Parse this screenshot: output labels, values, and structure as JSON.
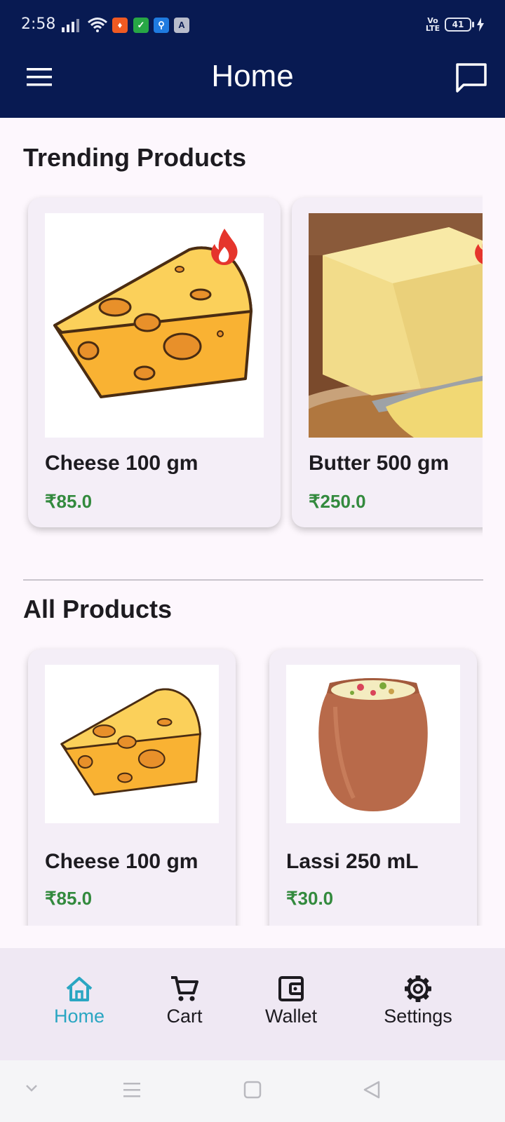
{
  "status_bar": {
    "time": "2:58",
    "volte": "Vo LTE",
    "battery": "41"
  },
  "app_bar": {
    "title": "Home",
    "menu_icon": "hamburger-menu-icon",
    "chat_icon": "chat-bubble-icon"
  },
  "trending": {
    "title": "Trending Products",
    "items": [
      {
        "name": "Cheese 100 gm",
        "price": "₹85.0",
        "image": "cheese-wedge",
        "badge": "fire-icon"
      },
      {
        "name": "Butter 500 gm",
        "price": "₹250.0",
        "image": "butter-block",
        "badge": "fire-icon"
      }
    ]
  },
  "all_products": {
    "title": "All Products",
    "items": [
      {
        "name": "Cheese 100 gm",
        "price": "₹85.0",
        "image": "cheese-wedge"
      },
      {
        "name": "Lassi 250 mL",
        "price": "₹30.0",
        "image": "lassi-clay-pot"
      }
    ]
  },
  "bottom_nav": {
    "items": [
      {
        "label": "Home",
        "icon": "home-icon",
        "active": true
      },
      {
        "label": "Cart",
        "icon": "cart-icon",
        "active": false
      },
      {
        "label": "Wallet",
        "icon": "wallet-icon",
        "active": false
      },
      {
        "label": "Settings",
        "icon": "gear-icon",
        "active": false
      }
    ]
  },
  "colors": {
    "app_bar": "#081a52",
    "price": "#338a3e",
    "active_nav": "#2aa6c2",
    "fire": "#e5352c"
  }
}
